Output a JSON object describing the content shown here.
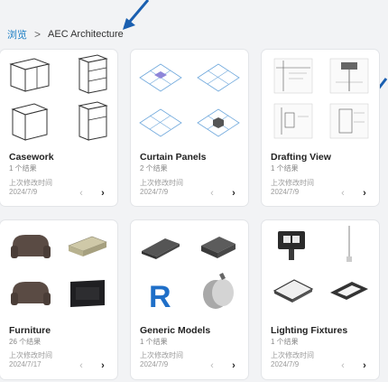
{
  "breadcrumb": {
    "root": "浏览",
    "separator": ">",
    "current": "AEC Architecture"
  },
  "labels": {
    "modified": "上次修改时间",
    "prev_icon": "‹",
    "next_icon": "›"
  },
  "cards": [
    {
      "title": "Casework",
      "count": "1 个结果",
      "date": "2024/7/9"
    },
    {
      "title": "Curtain Panels",
      "count": "2 个结果",
      "date": "2024/7/9"
    },
    {
      "title": "Drafting View",
      "count": "1 个结果",
      "date": "2024/7/9"
    },
    {
      "title": "Furniture",
      "count": "26 个结果",
      "date": "2024/7/17"
    },
    {
      "title": "Generic Models",
      "count": "1 个结果",
      "date": "2024/7/9"
    },
    {
      "title": "Lighting Fixtures",
      "count": "1 个结果",
      "date": "2024/7/9"
    }
  ],
  "colors": {
    "accent_link": "#1a7dc4",
    "annotation_arrow": "#1a5fb0"
  }
}
